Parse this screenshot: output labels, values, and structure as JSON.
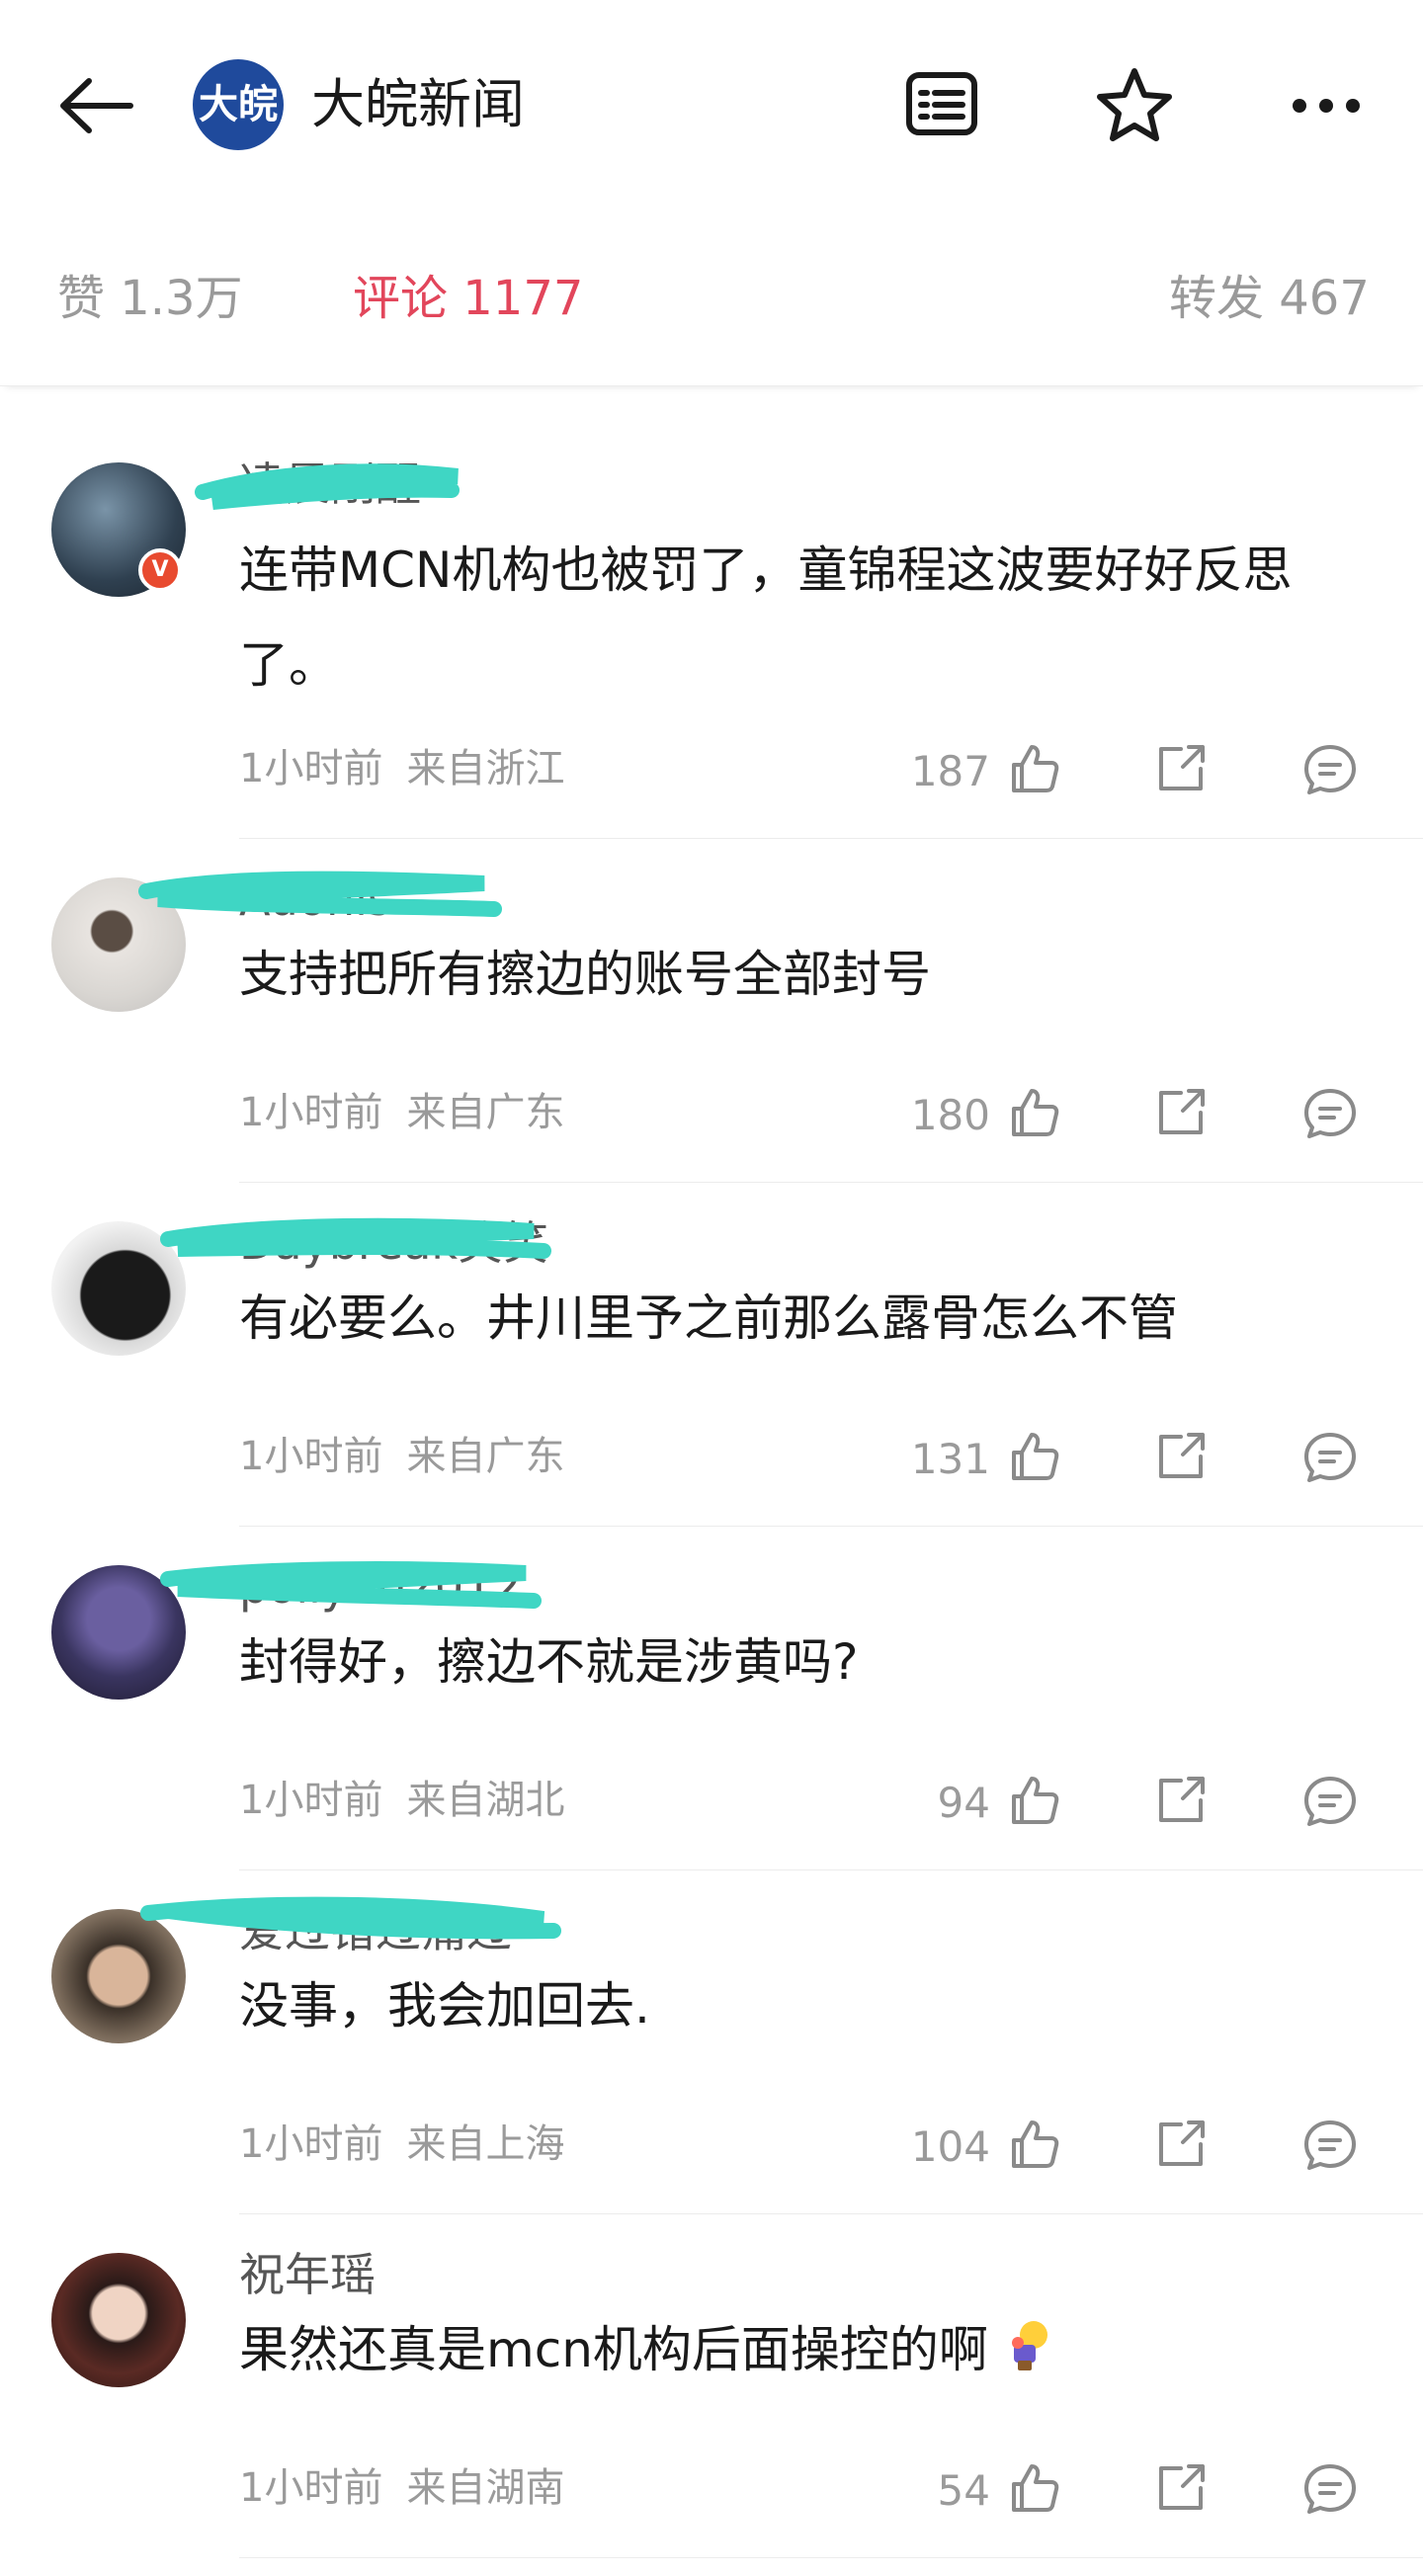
{
  "header": {
    "source_name": "大皖新闻",
    "logo_text": "大皖"
  },
  "tabs": [
    {
      "label": "赞 1.3万"
    },
    {
      "label": "评论 1177"
    },
    {
      "label": "转发 467"
    }
  ],
  "comments": [
    {
      "username": "凌晨刚醒",
      "text": "连带MCN机构也被罚了，童锦程这波要好好反思了。",
      "time": "1小时前",
      "location": "来自浙江",
      "likes": "187"
    },
    {
      "username": "Adonis-",
      "text": "支持把所有擦边的账号全部封号",
      "time": "1小时前",
      "location": "来自广东",
      "likes": "180"
    },
    {
      "username": "Daybreak笑笑",
      "text": "有必要么。井川里予之前那么露骨怎么不管",
      "time": "1小时前",
      "location": "来自广东",
      "likes": "131"
    },
    {
      "username": "polly202012",
      "text": "封得好，擦边不就是涉黄吗?",
      "time": "1小时前",
      "location": "来自湖北",
      "likes": "94"
    },
    {
      "username": "爱过错过痛过",
      "text": "没事，我会加回去.",
      "time": "1小时前",
      "location": "来自上海",
      "likes": "104"
    },
    {
      "username": "祝年瑶",
      "text": "果然还真是mcn机构后面操控的啊",
      "time": "1小时前",
      "location": "来自湖南",
      "likes": "54"
    }
  ],
  "colors": {
    "accent": "#e2465b",
    "muted": "#9a9a9a",
    "scribble": "#3fd6c4"
  }
}
